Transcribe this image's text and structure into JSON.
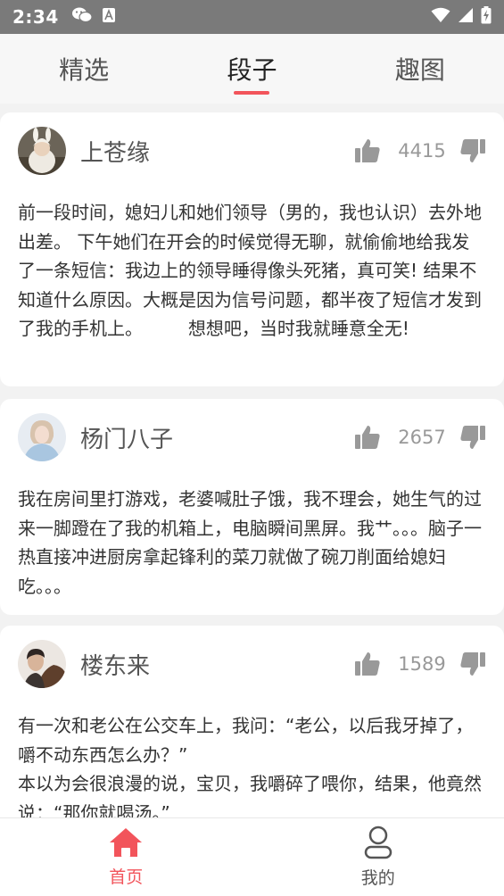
{
  "status_bar": {
    "time": "2:34",
    "icons": [
      "wechat-icon",
      "notification-a-icon",
      "wifi-icon",
      "signal-icon",
      "battery-charging-icon"
    ]
  },
  "top_tabs": [
    {
      "label": "精选",
      "active": false
    },
    {
      "label": "段子",
      "active": true
    },
    {
      "label": "趣图",
      "active": false
    }
  ],
  "colors": {
    "accent": "#f2545b",
    "status_bar": "#7a7a7a",
    "text_primary": "#333333",
    "text_secondary": "#555555",
    "count": "#999999"
  },
  "posts": [
    {
      "author": "上苍缘",
      "likes": "4415",
      "content": "前一段时间，媳妇儿和她们领导（男的，我也认识）去外地出差。 下午她们在开会的时候觉得无聊，就偷偷地给我发了一条短信：我边上的领导睡得像头死猪，真可笑! 结果不知道什么原因。大概是因为信号问题，都半夜了短信才发到了我的手机上。        想想吧，当时我就睡意全无!"
    },
    {
      "author": "杨门八子",
      "likes": "2657",
      "content": "我在房间里打游戏，老婆喊肚子饿，我不理会，她生气的过来一脚蹬在了我的机箱上，电脑瞬间黑屏。我艹。。。脑子一热直接冲进厨房拿起锋利的菜刀就做了碗刀削面给媳妇吃。。。"
    },
    {
      "author": "楼东来",
      "likes": "1589",
      "content": "有一次和老公在公交车上，我问：“老公，以后我牙掉了，嚼不动东西怎么办？”\n本以为会很浪漫的说，宝贝，我嚼碎了喂你，结果，他竟然说：“那你就喝汤。”"
    }
  ],
  "bottom_nav": [
    {
      "label": "首页",
      "icon": "home-icon",
      "active": true
    },
    {
      "label": "我的",
      "icon": "user-icon",
      "active": false
    }
  ]
}
